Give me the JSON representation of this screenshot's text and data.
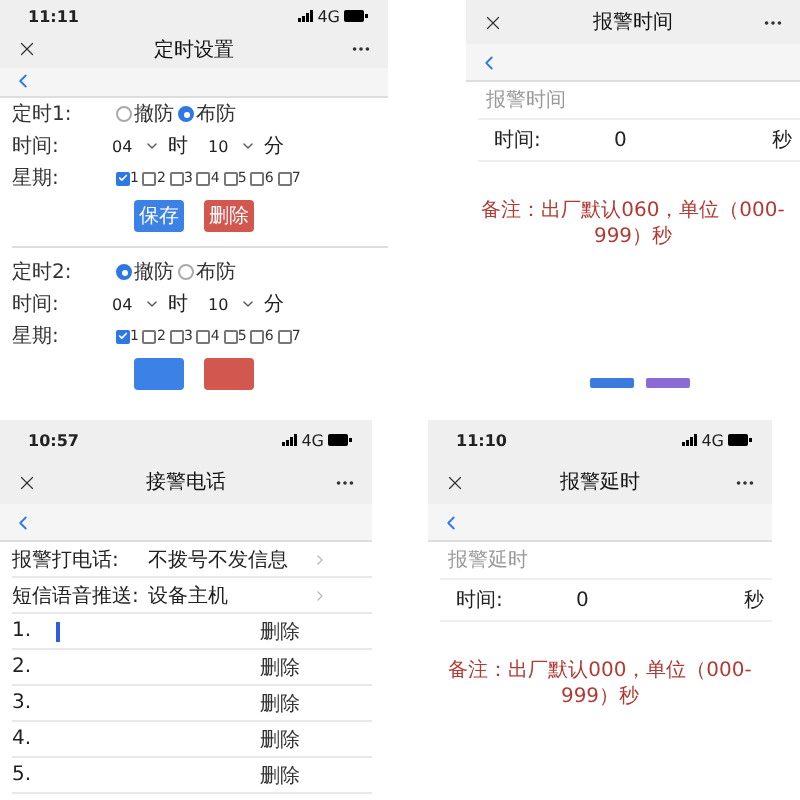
{
  "screens": [
    {
      "kind": "timer",
      "status": {
        "time": "11:11",
        "network": "4G"
      },
      "title": "定时设置",
      "timers": [
        {
          "label": "定时1:",
          "modes": [
            {
              "label": "撤防",
              "selected": false
            },
            {
              "label": "布防",
              "selected": true
            }
          ],
          "time_label": "时间:",
          "hour": "04",
          "hour_unit": "时",
          "minute": "10",
          "minute_unit": "分",
          "week_label": "星期:",
          "days": [
            {
              "label": "1",
              "checked": true
            },
            {
              "label": "2",
              "checked": false
            },
            {
              "label": "3",
              "checked": false
            },
            {
              "label": "4",
              "checked": false
            },
            {
              "label": "5",
              "checked": false
            },
            {
              "label": "6",
              "checked": false
            },
            {
              "label": "7",
              "checked": false
            }
          ],
          "buttons": [
            {
              "kind": "save",
              "label": "保存"
            },
            {
              "kind": "delete",
              "label": "删除"
            }
          ]
        },
        {
          "label": "定时2:",
          "modes": [
            {
              "label": "撤防",
              "selected": true
            },
            {
              "label": "布防",
              "selected": false
            }
          ],
          "time_label": "时间:",
          "hour": "04",
          "hour_unit": "时",
          "minute": "10",
          "minute_unit": "分",
          "week_label": "星期:",
          "days": [
            {
              "label": "1",
              "checked": true
            },
            {
              "label": "2",
              "checked": false
            },
            {
              "label": "3",
              "checked": false
            },
            {
              "label": "4",
              "checked": false
            },
            {
              "label": "5",
              "checked": false
            },
            {
              "label": "6",
              "checked": false
            },
            {
              "label": "7",
              "checked": false
            }
          ],
          "buttons": [
            {
              "kind": "save"
            },
            {
              "kind": "delete"
            }
          ]
        }
      ]
    },
    {
      "kind": "delay",
      "title": "报警时间",
      "section": "报警时间",
      "row_label": "时间:",
      "value": "0",
      "unit": "秒",
      "note": "备注：出厂默认060，单位（000-999）秒",
      "footer_buttons": [
        {
          "color": "#3b7be0"
        },
        {
          "color": "#8a6bd6"
        }
      ]
    },
    {
      "kind": "phone",
      "status": {
        "time": "10:57",
        "network": "4G"
      },
      "title": "接警电话",
      "settings": [
        {
          "label": "报警打电话:",
          "value": "不拨号不发信息"
        },
        {
          "label": "短信语音推送:",
          "value": "设备主机"
        }
      ],
      "numbers": [
        {
          "index": "1.",
          "action": "删除",
          "focused": true
        },
        {
          "index": "2.",
          "action": "删除",
          "focused": false
        },
        {
          "index": "3.",
          "action": "删除",
          "focused": false
        },
        {
          "index": "4.",
          "action": "删除",
          "focused": false
        },
        {
          "index": "5.",
          "action": "删除",
          "focused": false
        }
      ]
    },
    {
      "kind": "delay",
      "status": {
        "time": "11:10",
        "network": "4G"
      },
      "title": "报警延时",
      "section": "报警延时",
      "row_label": "时间:",
      "value": "0",
      "unit": "秒",
      "note": "备注：出厂默认000，单位（000-999）秒"
    }
  ]
}
